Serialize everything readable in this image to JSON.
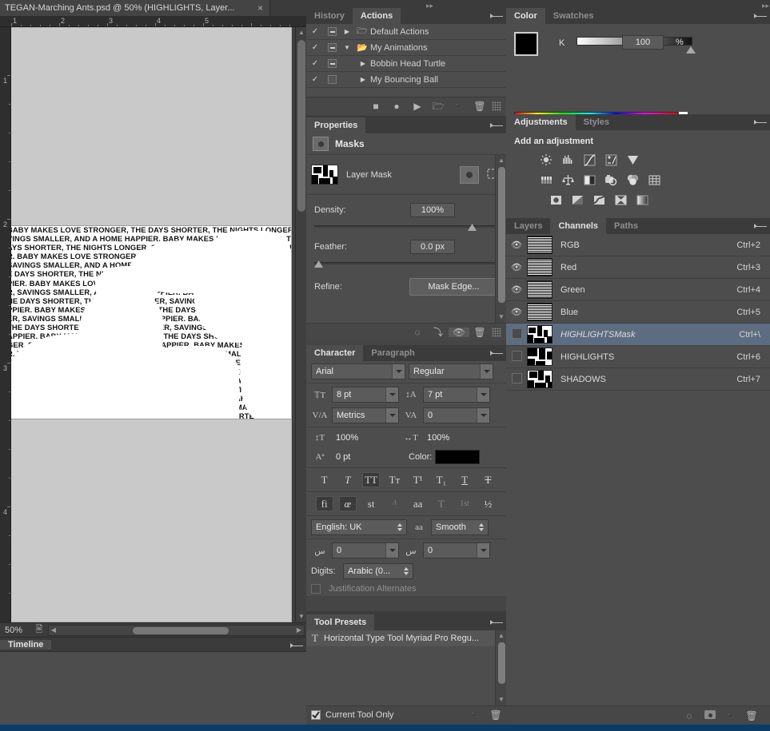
{
  "document": {
    "tab_title": "TEGAN-Marching Ants.psd @ 50% (HIGHLIGHTS, Layer...",
    "close_glyph": "×",
    "zoom_level": "50%",
    "artwork_text": "BABY MAKES LOVE STRONGER, THE DAYS SHORTER, THE NIGHTS LONGER, SAVINGS SMALLER, AND A HOME HAPPIER. ",
    "ruler_h_numbers": [
      "1",
      "2",
      "3",
      "4",
      "5"
    ],
    "ruler_v_numbers": [
      "1",
      "2",
      "3",
      "4"
    ]
  },
  "timeline": {
    "tab_label": "Timeline"
  },
  "actions": {
    "tabs": [
      {
        "label": "History",
        "active": false
      },
      {
        "label": "Actions",
        "active": true
      }
    ],
    "rows": [
      {
        "check": "✓",
        "box": "filled",
        "tri": "▶",
        "folder": "🗀",
        "name": "Default Actions",
        "indent": 0
      },
      {
        "check": "✓",
        "box": "filled",
        "tri": "▼",
        "folder": "🗁",
        "name": "My Animations",
        "indent": 0
      },
      {
        "check": "✓",
        "box": "filled",
        "tri": "▶",
        "folder": "",
        "name": "Bobbin Head Turtle",
        "indent": 1
      },
      {
        "check": "✓",
        "box": "empty",
        "tri": "▶",
        "folder": "",
        "name": "My Bouncing Ball",
        "indent": 1
      }
    ],
    "footer_icons": [
      "stop-icon",
      "record-icon",
      "play-icon",
      "new-set-icon",
      "new-action-icon",
      "delete-icon"
    ]
  },
  "properties": {
    "tab_label": "Properties",
    "title": "Masks",
    "mask_label": "Layer Mask",
    "density_label": "Density:",
    "density_value": "100%",
    "feather_label": "Feather:",
    "feather_value": "0.0 px",
    "refine_label": "Refine:",
    "mask_edge_button": "Mask Edge...",
    "footer_icons": [
      "load-selection-icon",
      "apply-mask-icon",
      "toggle-mask-icon",
      "delete-mask-icon"
    ]
  },
  "character": {
    "tabs": [
      {
        "label": "Character",
        "active": true
      },
      {
        "label": "Paragraph",
        "active": false
      }
    ],
    "font_family": "Arial",
    "font_style": "Regular",
    "font_size": "8 pt",
    "leading": "7 pt",
    "kerning": "Metrics",
    "tracking": "0",
    "vertical_scale": "100%",
    "horizontal_scale": "100%",
    "baseline_shift": "0 pt",
    "color_label": "Color:",
    "color_value": "#000000",
    "style_buttons": [
      "Bold",
      "Italic",
      "All Caps",
      "Small Caps",
      "Superscript",
      "Subscript",
      "Underline",
      "Strikethrough"
    ],
    "style_glyphs": [
      "T",
      "T",
      "TT",
      "Tт",
      "T¹",
      "T₁",
      "T",
      "T"
    ],
    "style_active_index": 2,
    "opentype_glyphs": [
      "fi",
      "œ",
      "st",
      "ᴬ",
      "aa",
      "T",
      "1st",
      "½"
    ],
    "opentype_active": [
      0,
      1
    ],
    "language": "English: UK",
    "antialias": "Smooth",
    "antialias_icon": "aa",
    "arabic_left": "0",
    "arabic_right": "0",
    "digits_label": "Digits:",
    "digits_value": "Arabic (0...",
    "justification_alternates": "Justification Alternates",
    "justification_checked": false
  },
  "tool_presets": {
    "tab_label": "Tool Presets",
    "items": [
      {
        "icon": "type-tool-icon",
        "label": "Horizontal Type Tool Myriad Pro Regu..."
      }
    ],
    "current_tool_only": "Current Tool Only",
    "current_tool_only_checked": true,
    "footer_icons": [
      "new-preset-icon",
      "delete-preset-icon"
    ]
  },
  "color": {
    "tabs": [
      {
        "label": "Color",
        "active": true
      },
      {
        "label": "Swatches",
        "active": false
      }
    ],
    "channel_label": "K",
    "channel_value": "100",
    "percent_symbol": "%",
    "foreground": "#000000",
    "background": "#ffffff"
  },
  "adjustments": {
    "tabs": [
      {
        "label": "Adjustments",
        "active": true
      },
      {
        "label": "Styles",
        "active": false
      }
    ],
    "heading": "Add an adjustment",
    "row1": [
      "brightness-contrast-icon",
      "levels-icon",
      "curves-icon",
      "exposure-icon",
      "vibrance-icon"
    ],
    "row2": [
      "hue-saturation-icon",
      "color-balance-icon",
      "black-white-icon",
      "photo-filter-icon",
      "channel-mixer-icon",
      "color-lookup-icon"
    ],
    "row3": [
      "invert-icon",
      "posterize-icon",
      "threshold-icon",
      "selective-color-icon",
      "gradient-map-icon"
    ]
  },
  "channels": {
    "tabs": [
      {
        "label": "Layers",
        "active": false
      },
      {
        "label": "Channels",
        "active": true
      },
      {
        "label": "Paths",
        "active": false
      }
    ],
    "rows": [
      {
        "visible": true,
        "name": "RGB",
        "shortcut": "Ctrl+2",
        "selected": false,
        "italic": false,
        "thumb": "noisy"
      },
      {
        "visible": true,
        "name": "Red",
        "shortcut": "Ctrl+3",
        "selected": false,
        "italic": false,
        "thumb": "noisy"
      },
      {
        "visible": true,
        "name": "Green",
        "shortcut": "Ctrl+4",
        "selected": false,
        "italic": false,
        "thumb": "noisy"
      },
      {
        "visible": true,
        "name": "Blue",
        "shortcut": "Ctrl+5",
        "selected": false,
        "italic": false,
        "thumb": "noisy"
      },
      {
        "visible": false,
        "name": "HIGHLIGHTSMask",
        "shortcut": "Ctrl+\\",
        "selected": true,
        "italic": true,
        "thumb": "solid"
      },
      {
        "visible": false,
        "name": "HIGHLIGHTS",
        "shortcut": "Ctrl+6",
        "selected": false,
        "italic": false,
        "thumb": "solid"
      },
      {
        "visible": false,
        "name": "SHADOWS",
        "shortcut": "Ctrl+7",
        "selected": false,
        "italic": false,
        "thumb": "solid"
      }
    ],
    "footer_icons": [
      "load-channel-selection-icon",
      "save-selection-icon",
      "new-channel-icon",
      "delete-channel-icon"
    ],
    "selected_row_color": "#5d6d81"
  },
  "theme": {
    "panel_bg": "#4d4d4d",
    "chrome_bg": "#3b3b3b",
    "text": "#d0d0d0",
    "taskbar": "#0b3c69"
  }
}
